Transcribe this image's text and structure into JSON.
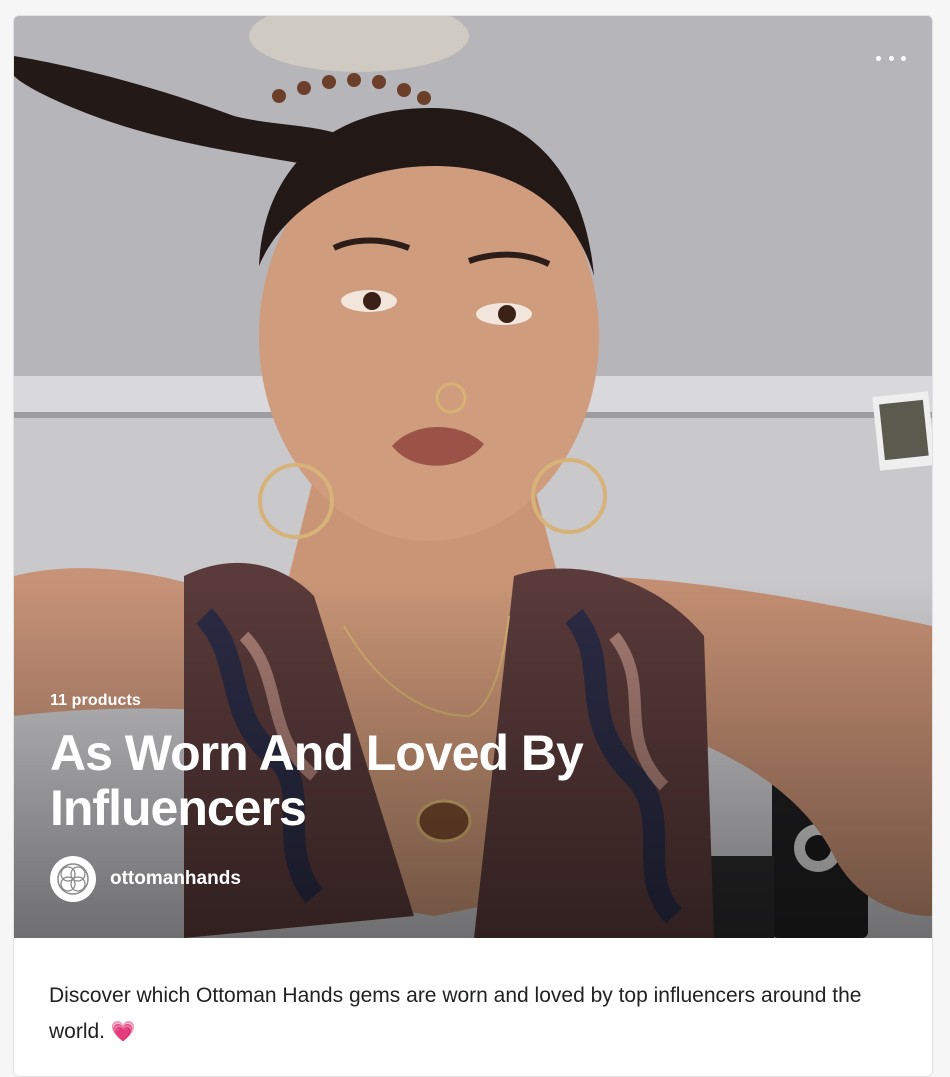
{
  "card": {
    "product_count": "11 products",
    "title": "As Worn And Loved By Influencers",
    "author": "ottomanhands",
    "description": "Discover which Ottoman Hands gems are worn and loved by top influencers around the world.",
    "description_emoji": "💗"
  },
  "icons": {
    "more": "more-horizontal-icon",
    "avatar": "ottomanhands-logo"
  },
  "colors": {
    "text_dark": "#202223",
    "overlay_text": "#ffffff",
    "heart": "#ff4d8d"
  }
}
